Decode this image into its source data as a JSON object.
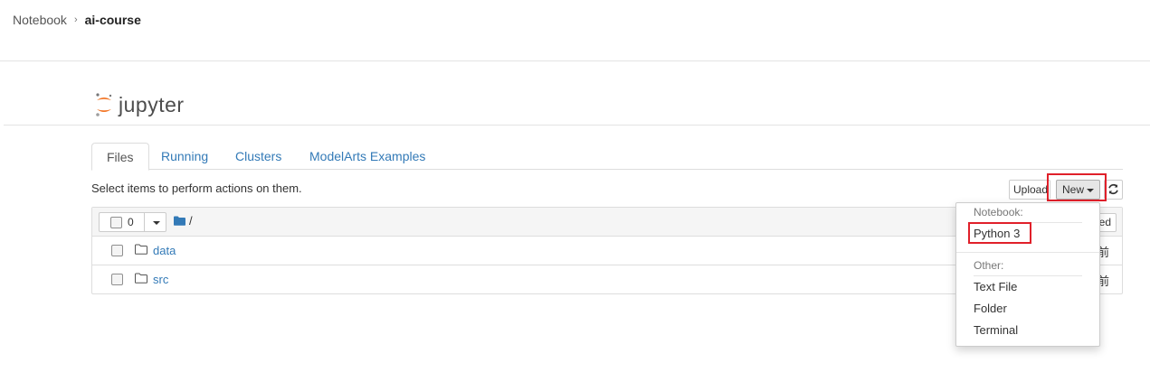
{
  "breadcrumb": {
    "root": "Notebook",
    "current": "ai-course"
  },
  "logo": {
    "wordmark": "jupyter",
    "accent_color": "#f37626"
  },
  "tabs": [
    {
      "label": "Files",
      "active": true
    },
    {
      "label": "Running",
      "active": false
    },
    {
      "label": "Clusters",
      "active": false
    },
    {
      "label": "ModelArts Examples",
      "active": false
    }
  ],
  "toolbar": {
    "hint": "Select items to perform actions on them.",
    "upload_label": "Upload",
    "new_label": "New",
    "refresh_icon": "refresh-icon"
  },
  "listing": {
    "selected_count": "0",
    "path": "/",
    "sort_label": "ed",
    "items": [
      {
        "name": "data",
        "type": "folder",
        "modified": "前"
      },
      {
        "name": "src",
        "type": "folder",
        "modified": "前"
      }
    ]
  },
  "new_menu": {
    "notebook_header": "Notebook:",
    "kernels": [
      "Python 3"
    ],
    "other_header": "Other:",
    "other_items": [
      "Text File",
      "Folder",
      "Terminal"
    ]
  },
  "colors": {
    "link": "#337ab7",
    "highlight": "#e0202a"
  }
}
